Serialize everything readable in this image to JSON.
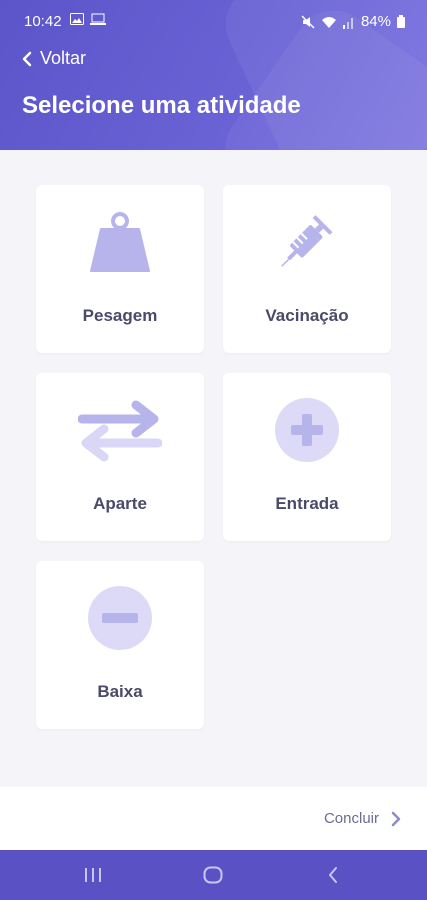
{
  "status_bar": {
    "time": "10:42",
    "battery": "84%"
  },
  "header": {
    "back_label": "Voltar",
    "title": "Selecione uma atividade"
  },
  "activities": [
    {
      "label": "Pesagem",
      "icon": "weight-icon"
    },
    {
      "label": "Vacinação",
      "icon": "syringe-icon"
    },
    {
      "label": "Aparte",
      "icon": "swap-arrows-icon"
    },
    {
      "label": "Entrada",
      "icon": "plus-circle-icon"
    },
    {
      "label": "Baixa",
      "icon": "minus-circle-icon"
    }
  ],
  "footer": {
    "concluir_label": "Concluir"
  },
  "colors": {
    "accent": "#5b55c9",
    "icon_fill": "#b7b4ec",
    "icon_bg": "#dcdaf6",
    "label": "#4a4a6a"
  }
}
